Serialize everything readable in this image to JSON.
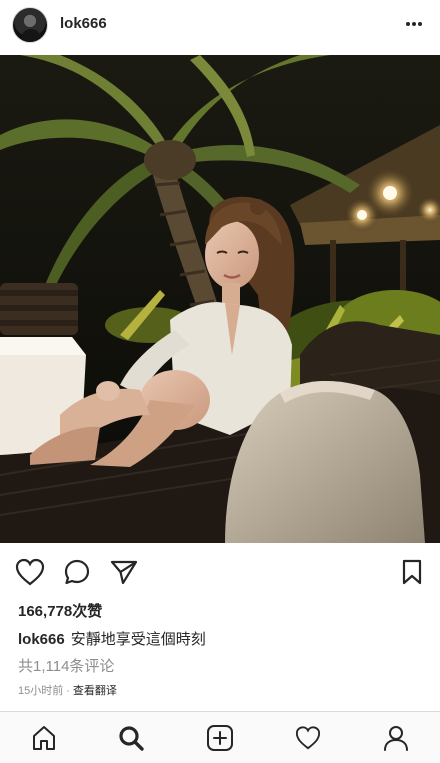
{
  "header": {
    "username": "lok666",
    "avatar_icon": "avatar-icon",
    "more_icon": "more-horizontal-icon"
  },
  "photo": {
    "description_icon": "post-photo"
  },
  "actions": {
    "like_icon": "heart-outline-icon",
    "comment_icon": "comment-bubble-icon",
    "share_icon": "paper-plane-icon",
    "save_icon": "bookmark-icon"
  },
  "post": {
    "likes": "166,778次赞",
    "caption_user": "lok666",
    "caption_text": "安靜地享受這個時刻",
    "comments": "共1,114条评论",
    "time": "15小时前",
    "dot": "·",
    "translate": "查看翻译"
  },
  "nav": {
    "items": [
      {
        "icon": "home-icon",
        "active": false
      },
      {
        "icon": "search-icon",
        "active": true
      },
      {
        "icon": "add-post-icon",
        "active": false
      },
      {
        "icon": "activity-heart-icon",
        "active": false
      },
      {
        "icon": "profile-icon",
        "active": false
      }
    ]
  },
  "colors": {
    "text": "#262626",
    "secondary": "#8e8e8e",
    "border": "#dbdbdb",
    "nav_bg": "#fafafa"
  }
}
